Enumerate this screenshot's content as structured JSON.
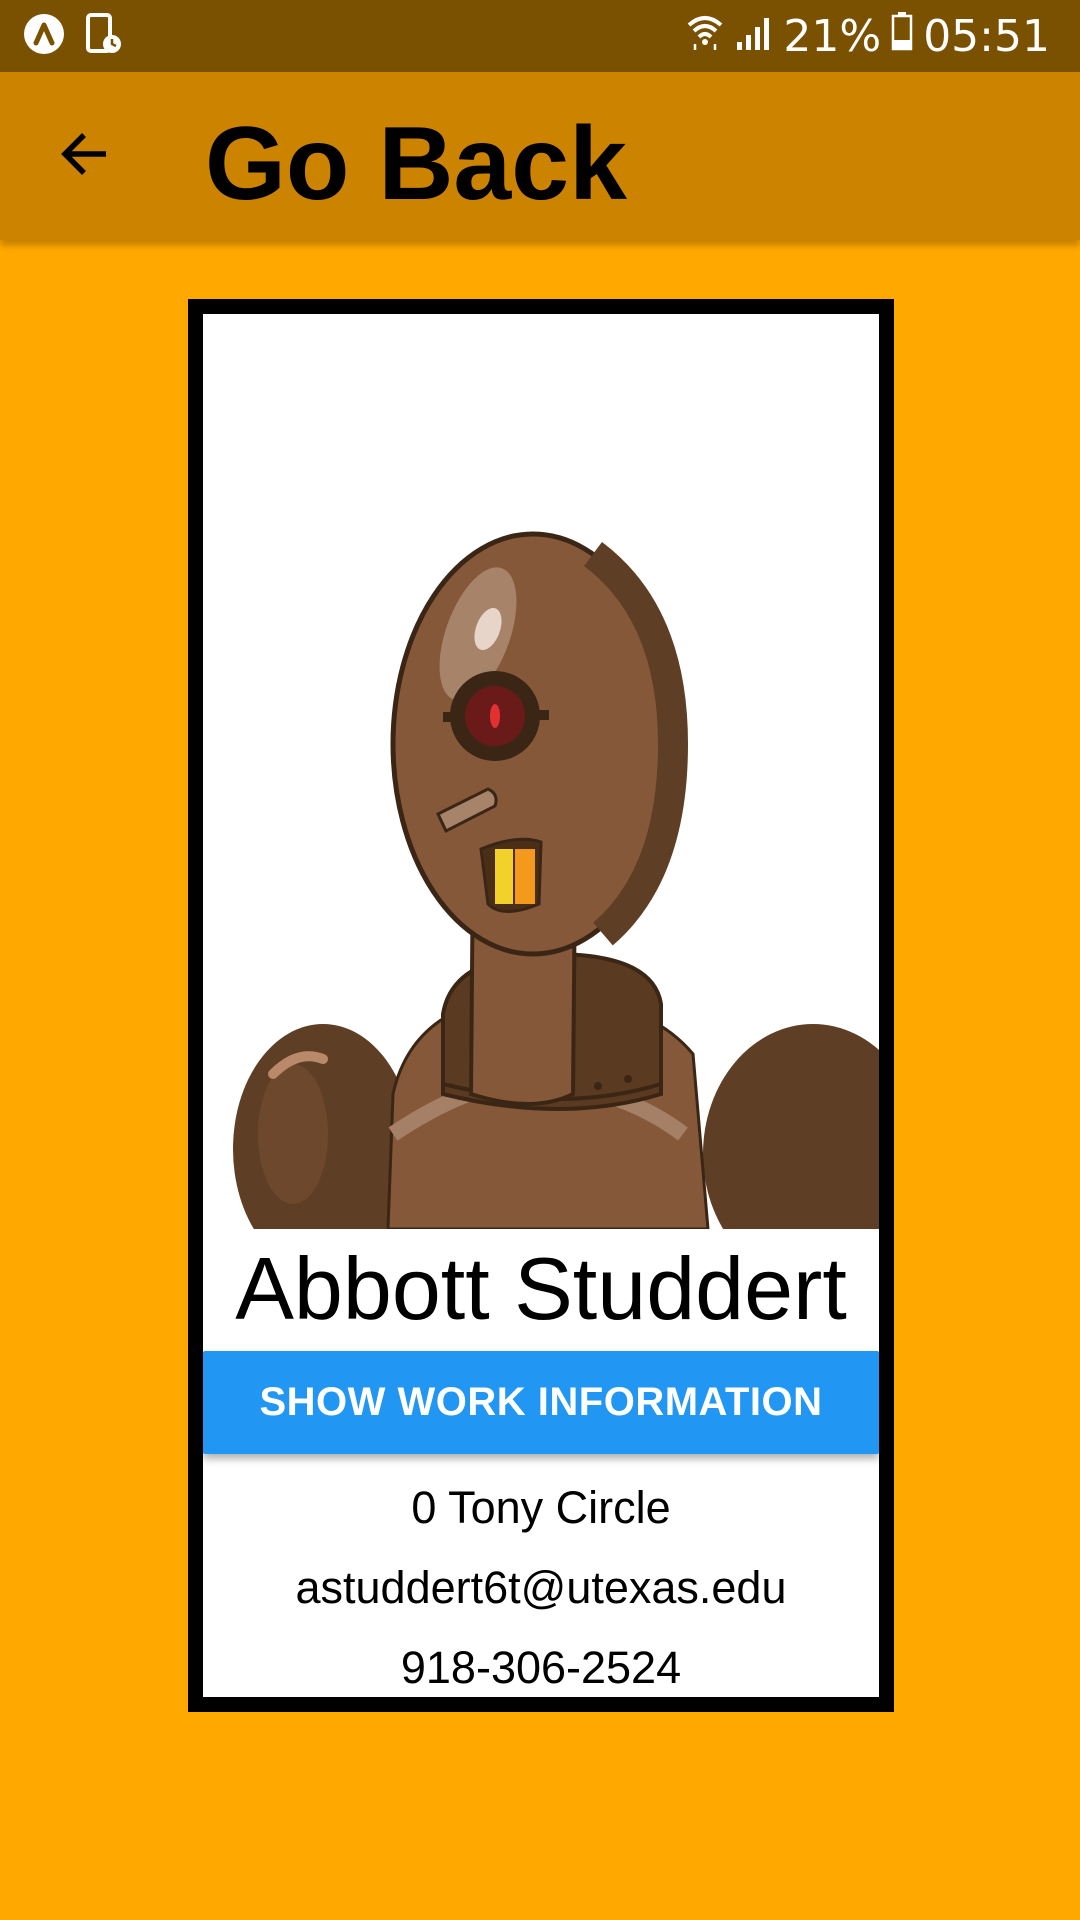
{
  "status_bar": {
    "battery": "21%",
    "time": "05:51",
    "icons": [
      "app-logo-icon",
      "screen-rotate-icon",
      "wifi-icon",
      "signal-icon",
      "battery-icon"
    ]
  },
  "app_bar": {
    "title": "Go Back",
    "back_icon": "arrow-left-icon"
  },
  "contact": {
    "name": "Abbott Studdert",
    "button_label": "SHOW WORK INFORMATION",
    "address": "0 Tony Circle",
    "email": "astuddert6t@utexas.edu",
    "phone": "918-306-2524"
  },
  "colors": {
    "background": "#FFA800",
    "status_bar": "#7A5100",
    "app_bar": "#CC8400",
    "button": "#2196F3"
  }
}
